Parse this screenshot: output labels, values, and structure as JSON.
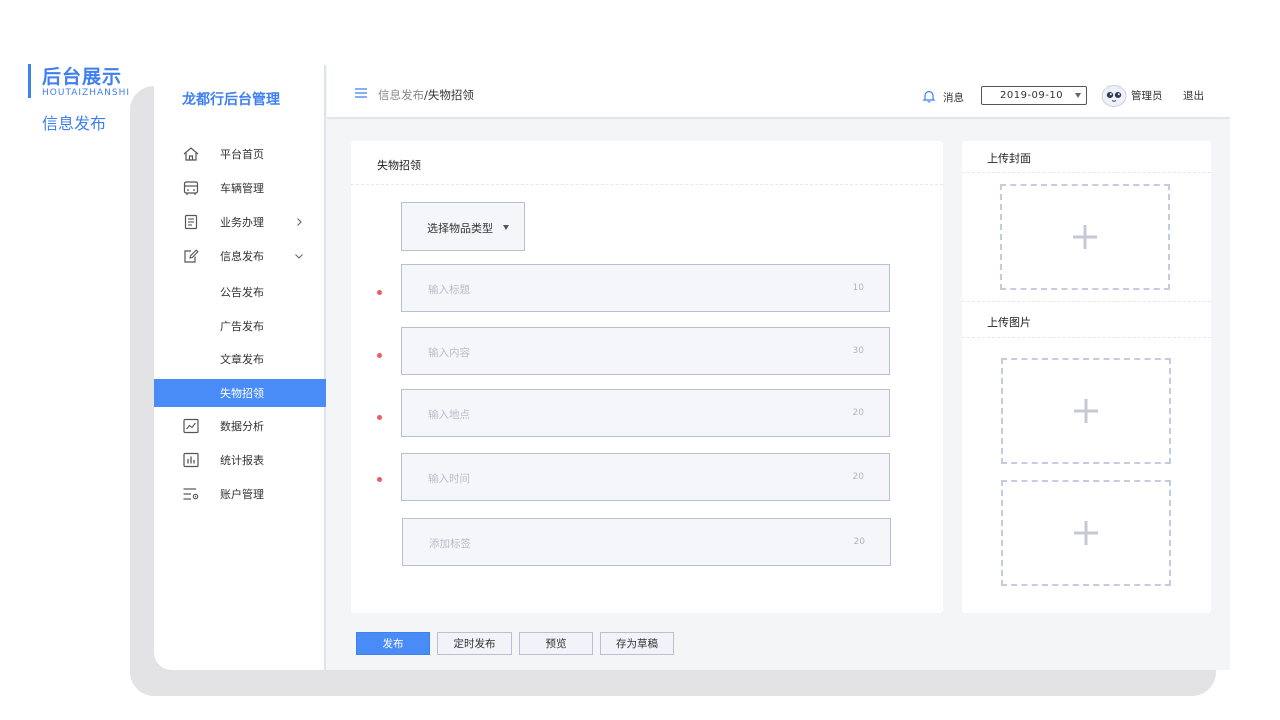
{
  "heading": {
    "title_cn": "后台展示",
    "title_en": "HOUTAIZHANSHI",
    "subtitle": "信息发布"
  },
  "sidebar": {
    "brand": "龙都行后台管理",
    "items": [
      {
        "label": "平台首页",
        "icon": "home-icon"
      },
      {
        "label": "车辆管理",
        "icon": "bus-icon"
      },
      {
        "label": "业务办理",
        "icon": "document-icon"
      },
      {
        "label": "信息发布",
        "icon": "edit-icon"
      },
      {
        "label": "公告发布"
      },
      {
        "label": "广告发布"
      },
      {
        "label": "文章发布"
      },
      {
        "label": "失物招领",
        "active": true
      },
      {
        "label": "数据分析",
        "icon": "line-chart-icon"
      },
      {
        "label": "统计报表",
        "icon": "bar-chart-icon"
      },
      {
        "label": "账户管理",
        "icon": "settings-list-icon"
      }
    ]
  },
  "header": {
    "breadcrumb": [
      "信息发布",
      "/",
      "失物招领"
    ],
    "messages_label": "消息",
    "date": "2019-09-10",
    "user": "管理员",
    "logout": "退出"
  },
  "form": {
    "title": "失物招领",
    "type_select": "选择物品类型",
    "fields": [
      {
        "placeholder": "输入标题",
        "limit": "10",
        "required": true
      },
      {
        "placeholder": "输入内容",
        "limit": "30",
        "required": true
      },
      {
        "placeholder": "输入地点",
        "limit": "20",
        "required": true
      },
      {
        "placeholder": "输入时间",
        "limit": "20",
        "required": true
      },
      {
        "placeholder": "添加标签",
        "limit": "20",
        "required": false
      }
    ]
  },
  "upload": {
    "cover_title": "上传封面",
    "images_title": "上传图片"
  },
  "actions": {
    "publish": "发布",
    "schedule": "定时发布",
    "preview": "预览",
    "draft": "存为草稿"
  },
  "colors": {
    "accent": "#4a8cf7",
    "required": "#f05a6b",
    "brand": "#3f7ff0"
  }
}
